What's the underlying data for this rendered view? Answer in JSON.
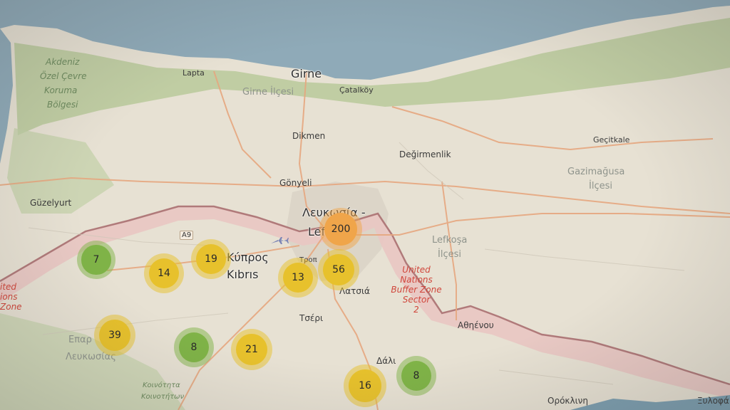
{
  "colors": {
    "sea": "#8faab8",
    "land": "#e7e1d3",
    "forest": "#b9c99a",
    "buffer": "#e9c7c2",
    "road": "#e6a77f",
    "cluster_small": "#7fb347",
    "cluster_medium": "#e7c12c",
    "cluster_large": "#f0a54a"
  },
  "places": {
    "girne": "Girne",
    "girne_ilcesi": "Girne İlçesi",
    "lapta": "Lapta",
    "catalkoy": "Çatalköy",
    "dikmen": "Dikmen",
    "degirmenlik": "Değirmenlik",
    "gecitkale": "Geçitkale",
    "gazimagusa": "Gazimağusa",
    "gazimagusa_ilcesi": "İlçesi",
    "gonyeli": "Gönyeli",
    "guzelyurt": "Güzelyurt",
    "lefkosa_top": "Λευκωσία -",
    "lefkosa_bottom": "Lefkoşa",
    "lefkosa_ilcesi_1": "Lefkoşa",
    "lefkosa_ilcesi_2": "İlçesi",
    "kibris_1": "Κύπρος",
    "kibris_2": "Kıbrıs",
    "latsia": "Λατσιά",
    "tseri": "Τσέρι",
    "dali": "Δάλι",
    "athienou": "Αθηένου",
    "orokline": "Ορόκλινη",
    "xylofagou": "Ξυλοφά",
    "eparchia_1": "Επαρ",
    "eparchia_2": "Λευκωσίας",
    "koinotita_1": "Κοινότητα",
    "koinotita_2": "Κοινοτήτων",
    "akdeniz_1": "Akdeniz",
    "akdeniz_2": "Özel Çevre",
    "akdeniz_3": "Koruma",
    "akdeniz_4": "Bölgesi",
    "trop": "Τροπ",
    "un_1": "United",
    "un_2": "Nations",
    "un_3": "Buffer Zone",
    "un_4": "Sector",
    "un_5": "2",
    "un_left_1": "ited",
    "un_left_2": "ions",
    "un_left_3": "Zone",
    "road_a9": "A9"
  },
  "clusters": [
    {
      "id": "c7",
      "count": "7",
      "level": "small"
    },
    {
      "id": "c14",
      "count": "14",
      "level": "medium"
    },
    {
      "id": "c19",
      "count": "19",
      "level": "medium"
    },
    {
      "id": "c200",
      "count": "200",
      "level": "large"
    },
    {
      "id": "c13",
      "count": "13",
      "level": "medium"
    },
    {
      "id": "c56",
      "count": "56",
      "level": "medium"
    },
    {
      "id": "c39",
      "count": "39",
      "level": "medium"
    },
    {
      "id": "c8a",
      "count": "8",
      "level": "small"
    },
    {
      "id": "c21",
      "count": "21",
      "level": "medium"
    },
    {
      "id": "c16",
      "count": "16",
      "level": "medium"
    },
    {
      "id": "c8b",
      "count": "8",
      "level": "small"
    }
  ]
}
